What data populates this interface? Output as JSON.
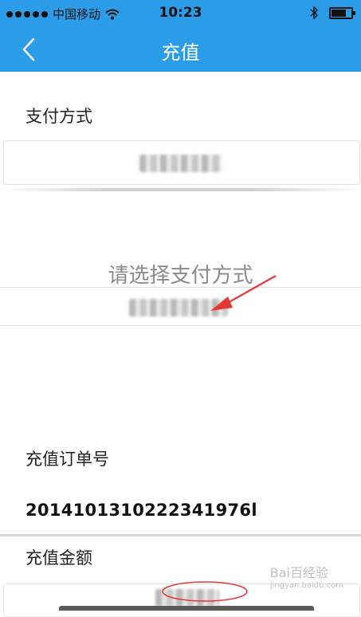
{
  "status": {
    "carrier": "中国移动",
    "time": "10:23"
  },
  "nav": {
    "title": "充值"
  },
  "payment": {
    "label": "支付方式",
    "picker_title": "请选择支付方式"
  },
  "order": {
    "label": "充值订单号",
    "number": "2014101310222341976l"
  },
  "amount": {
    "label": "充值金额"
  },
  "watermark": {
    "text": "Bai百经验",
    "sub": "jingyan.baidu.com"
  },
  "colors": {
    "accent": "#2a9ce8",
    "annotation": "#e53935"
  }
}
